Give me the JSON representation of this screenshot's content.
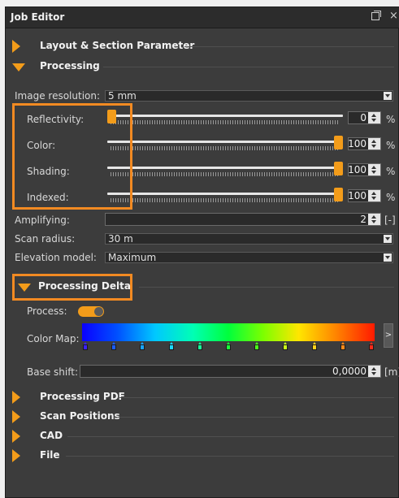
{
  "window": {
    "title": "Job Editor"
  },
  "sections": {
    "layout": "Layout & Section Parameter",
    "processing": "Processing",
    "processing_delta": "Processing Delta",
    "processing_pdf": "Processing PDF",
    "scan_positions": "Scan Positions",
    "cad": "CAD",
    "file": "File"
  },
  "processing": {
    "image_resolution": {
      "label": "Image resolution:",
      "value": "5 mm"
    },
    "reflectivity": {
      "label": "Reflectivity:",
      "value": "0",
      "unit": "%",
      "level": 0.0
    },
    "color": {
      "label": "Color:",
      "value": "100",
      "unit": "%",
      "level": 1.0
    },
    "shading": {
      "label": "Shading:",
      "value": "100",
      "unit": "%",
      "level": 1.0
    },
    "indexed": {
      "label": "Indexed:",
      "value": "100",
      "unit": "%",
      "level": 1.0
    },
    "amplifying": {
      "label": "Amplifying:",
      "value": "2",
      "unit": "[-]"
    },
    "scan_radius": {
      "label": "Scan radius:",
      "value": "30 m"
    },
    "elevation_model": {
      "label": "Elevation model:",
      "value": "Maximum"
    }
  },
  "delta": {
    "process": {
      "label": "Process:",
      "on": true
    },
    "color_map": {
      "label": "Color Map:",
      "more_glyph": ">",
      "stops": [
        "#3a20ff",
        "#1a5cff",
        "#18a4ff",
        "#1ad8ff",
        "#1aff9a",
        "#1aff3a",
        "#4cff1a",
        "#c8ff1a",
        "#ffd21a",
        "#ff8a1a",
        "#ff2a1a"
      ]
    },
    "base_shift": {
      "label": "Base shift:",
      "value": "0,0000",
      "unit": "[m]"
    }
  },
  "colors": {
    "accent": "#f39c1a",
    "highlight": "#f28a22",
    "panel": "#3c3c3c"
  }
}
